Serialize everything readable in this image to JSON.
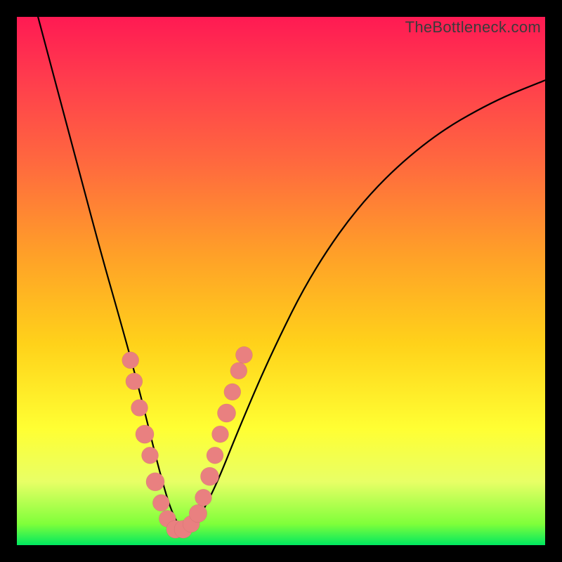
{
  "watermark": "TheBottleneck.com",
  "colors": {
    "bead": "#e98080",
    "curve": "#000000",
    "gradient_top": "#ff1a53",
    "gradient_bottom": "#00e860",
    "page_bg": "#000000"
  },
  "chart_data": {
    "type": "line",
    "title": "",
    "xlabel": "",
    "ylabel": "",
    "xlim": [
      0,
      100
    ],
    "ylim": [
      0,
      100
    ],
    "note": "Axes have no visible tick labels; values are normalized 0–100. The curve is a V-shaped bottleneck profile with minimum near x≈31. Background gradient encodes severity (red=high, green=low).",
    "series": [
      {
        "name": "bottleneck-curve",
        "x": [
          4,
          8,
          12,
          16,
          20,
          23,
          25,
          27,
          29,
          31,
          33,
          35,
          38,
          42,
          48,
          56,
          66,
          78,
          90,
          100
        ],
        "y": [
          100,
          85,
          70,
          55,
          41,
          30,
          22,
          14,
          7,
          3,
          3,
          6,
          12,
          22,
          36,
          52,
          66,
          77,
          84,
          88
        ]
      }
    ],
    "markers": [
      {
        "series": "bottleneck-curve",
        "x": 21.5,
        "y": 35,
        "r": 1.6
      },
      {
        "series": "bottleneck-curve",
        "x": 22.2,
        "y": 31,
        "r": 1.6
      },
      {
        "series": "bottleneck-curve",
        "x": 23.2,
        "y": 26,
        "r": 1.6
      },
      {
        "series": "bottleneck-curve",
        "x": 24.2,
        "y": 21,
        "r": 1.9
      },
      {
        "series": "bottleneck-curve",
        "x": 25.2,
        "y": 17,
        "r": 1.6
      },
      {
        "series": "bottleneck-curve",
        "x": 26.2,
        "y": 12,
        "r": 1.9
      },
      {
        "series": "bottleneck-curve",
        "x": 27.3,
        "y": 8,
        "r": 1.6
      },
      {
        "series": "bottleneck-curve",
        "x": 28.5,
        "y": 5,
        "r": 1.6
      },
      {
        "series": "bottleneck-curve",
        "x": 30.0,
        "y": 3,
        "r": 1.8
      },
      {
        "series": "bottleneck-curve",
        "x": 31.5,
        "y": 3,
        "r": 1.8
      },
      {
        "series": "bottleneck-curve",
        "x": 33.0,
        "y": 4,
        "r": 1.6
      },
      {
        "series": "bottleneck-curve",
        "x": 34.3,
        "y": 6,
        "r": 1.8
      },
      {
        "series": "bottleneck-curve",
        "x": 35.3,
        "y": 9,
        "r": 1.6
      },
      {
        "series": "bottleneck-curve",
        "x": 36.5,
        "y": 13,
        "r": 1.9
      },
      {
        "series": "bottleneck-curve",
        "x": 37.5,
        "y": 17,
        "r": 1.6
      },
      {
        "series": "bottleneck-curve",
        "x": 38.5,
        "y": 21,
        "r": 1.6
      },
      {
        "series": "bottleneck-curve",
        "x": 39.7,
        "y": 25,
        "r": 1.9
      },
      {
        "series": "bottleneck-curve",
        "x": 40.8,
        "y": 29,
        "r": 1.6
      },
      {
        "series": "bottleneck-curve",
        "x": 42.0,
        "y": 33,
        "r": 1.6
      },
      {
        "series": "bottleneck-curve",
        "x": 43.0,
        "y": 36,
        "r": 1.6
      }
    ]
  }
}
